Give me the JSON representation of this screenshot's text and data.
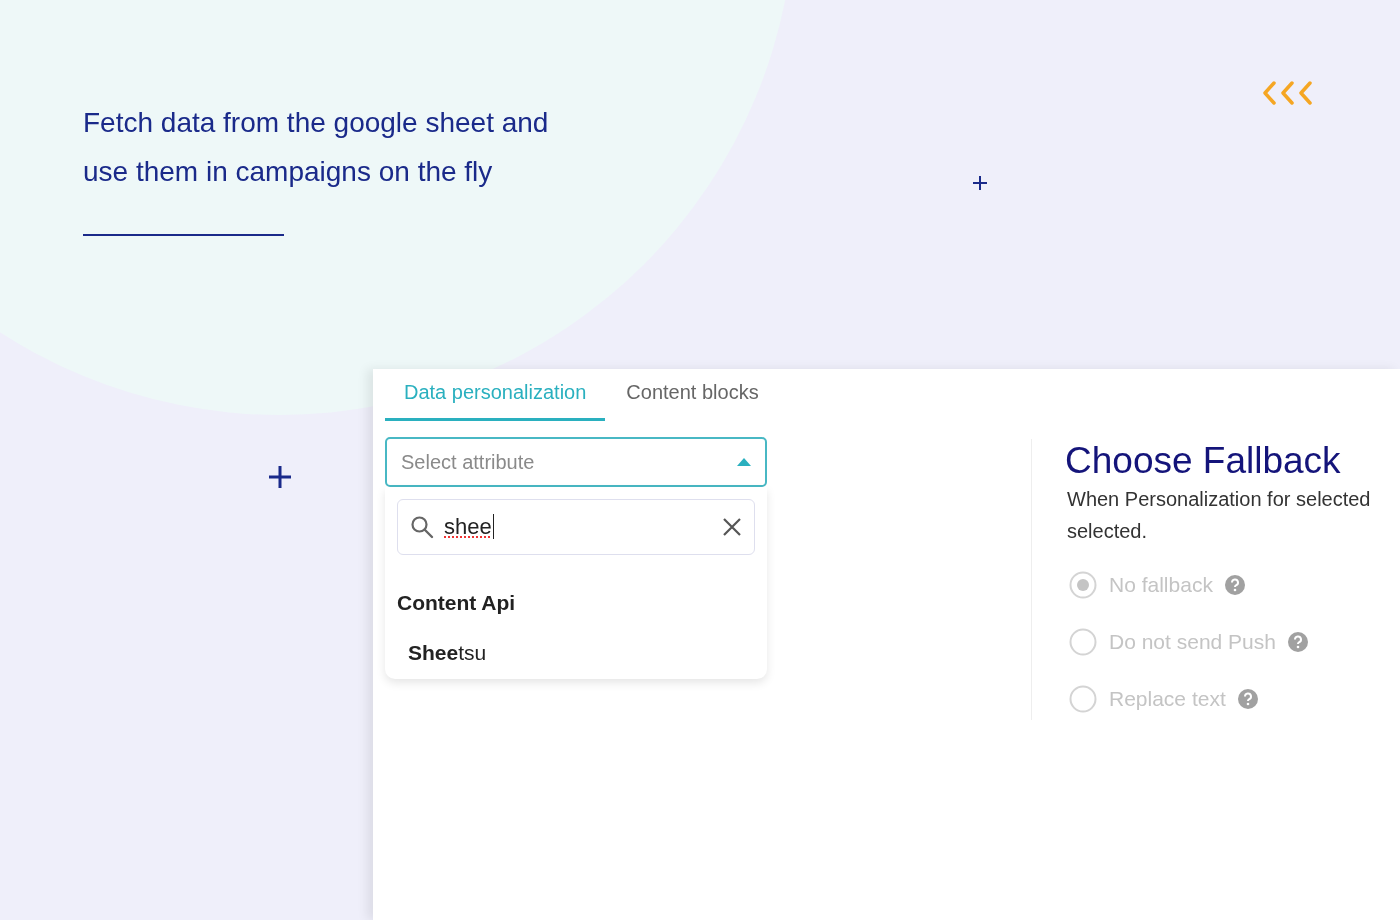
{
  "headline": [
    "Fetch data from the google sheet and",
    "use them in campaigns on the fly"
  ],
  "tabs": [
    {
      "label": "Data personalization",
      "selected": true
    },
    {
      "label": "Content blocks",
      "selected": false
    }
  ],
  "attribute_select": {
    "placeholder": "Select attribute",
    "expanded": true
  },
  "search": {
    "value": "shee"
  },
  "dropdown_groups": [
    {
      "label": "Content Api",
      "options": [
        "**Shee**tsu"
      ]
    }
  ],
  "fallback": {
    "title": "Choose Fallback",
    "description": [
      "When Personalization for selected",
      "selected."
    ],
    "options": [
      {
        "label": "No fallback",
        "selected": true,
        "disabled": true
      },
      {
        "label": "Do not send Push",
        "selected": false,
        "disabled": true
      },
      {
        "label": "Replace text",
        "selected": false,
        "disabled": true
      }
    ]
  }
}
